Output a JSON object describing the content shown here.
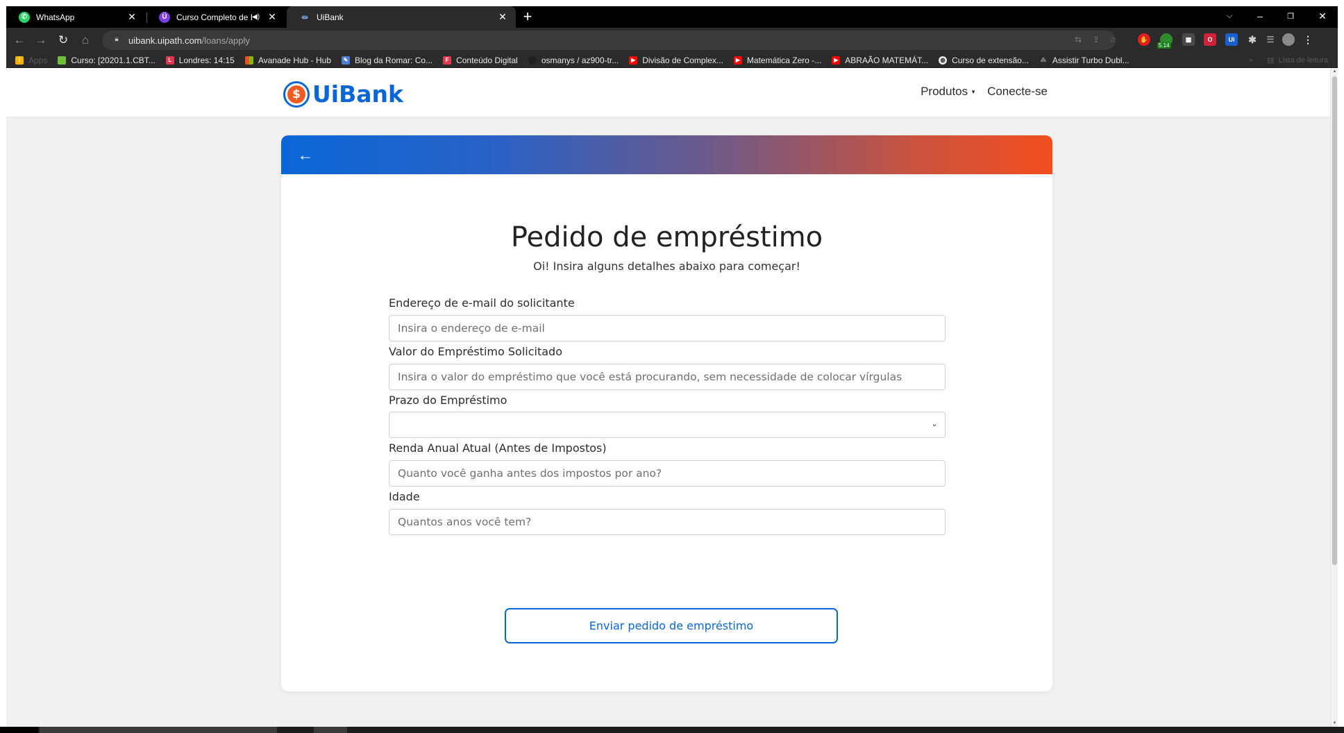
{
  "tabs": [
    {
      "title": "WhatsApp",
      "icon": "whatsapp-icon",
      "color": "#25d366",
      "muted": false,
      "active": false
    },
    {
      "title": "Curso Completo de Desenvo",
      "icon": "course-icon",
      "color": "#7b3fe4",
      "muted": true,
      "active": false
    },
    {
      "title": "UiBank",
      "icon": "bank-icon",
      "color": "#8ab4f8",
      "muted": false,
      "active": true
    }
  ],
  "address_bar": {
    "host": "uibank.uipath.com",
    "path": "/loans/apply"
  },
  "extensions": {
    "badge_text": "5.14"
  },
  "bookmarks": [
    {
      "label": "Apps",
      "icon": "apps-grid-icon",
      "color": "#f4b400",
      "faded": true
    },
    {
      "label": "Curso: [20201.1.CBT...",
      "icon": "bookmark-icon-green",
      "color": "#6fbf3a",
      "faded": false
    },
    {
      "label": "Londres: 14:15",
      "icon": "bookmark-icon-l",
      "color": "#e2354e",
      "faded": false
    },
    {
      "label": "Avanade Hub - Hub",
      "icon": "windows-icon",
      "color": "#f25022",
      "faded": false
    },
    {
      "label": "Blog da Romar: Co...",
      "icon": "bookmark-icon-pen",
      "color": "#4a7fd4",
      "faded": false
    },
    {
      "label": "Conteúdo Digital",
      "icon": "bookmark-icon-f",
      "color": "#e03a4e",
      "faded": false
    },
    {
      "label": "osmanys / az900-tr...",
      "icon": "github-icon",
      "color": "#202020",
      "faded": false
    },
    {
      "label": "Divisão de Complex...",
      "icon": "youtube-icon",
      "color": "#ff0000",
      "faded": false
    },
    {
      "label": "Matemática Zero -...",
      "icon": "youtube-icon",
      "color": "#ff0000",
      "faded": false
    },
    {
      "label": "ABRAÃO MATEMÁT...",
      "icon": "youtube-icon",
      "color": "#ff0000",
      "faded": false
    },
    {
      "label": "Curso de extensão...",
      "icon": "globe-icon",
      "color": "#e8e8e8",
      "faded": false
    },
    {
      "label": "Assistir Turbo Dubl...",
      "icon": "bookmark-icon-tv",
      "color": "#9a9a9a",
      "faded": false
    }
  ],
  "reading_list_label": "Lista de leitura",
  "site": {
    "logo_symbol": "$",
    "logo_text": "UiBank",
    "nav_products": "Produtos",
    "nav_connect": "Conecte-se"
  },
  "form": {
    "back_symbol": "←",
    "title": "Pedido de empréstimo",
    "subtitle": "Oi! Insira alguns detalhes abaixo para começar!",
    "email_label": "Endereço de e-mail do solicitante",
    "email_placeholder": "Insira o endereço de e-mail",
    "amount_label": "Valor do Empréstimo Solicitado",
    "amount_placeholder": "Insira o valor do empréstimo que você está procurando, sem necessidade de colocar vírgulas",
    "term_label": "Prazo do Empréstimo",
    "term_value": "",
    "income_label": "Renda Anual Atual (Antes de Impostos)",
    "income_placeholder": "Quanto você ganha antes dos impostos por ano?",
    "age_label": "Idade",
    "age_placeholder": "Quantos anos você tem?",
    "submit_label": "Enviar pedido de empréstimo"
  },
  "colors": {
    "brand_blue": "#0a66d6",
    "brand_orange": "#f24e1e"
  }
}
